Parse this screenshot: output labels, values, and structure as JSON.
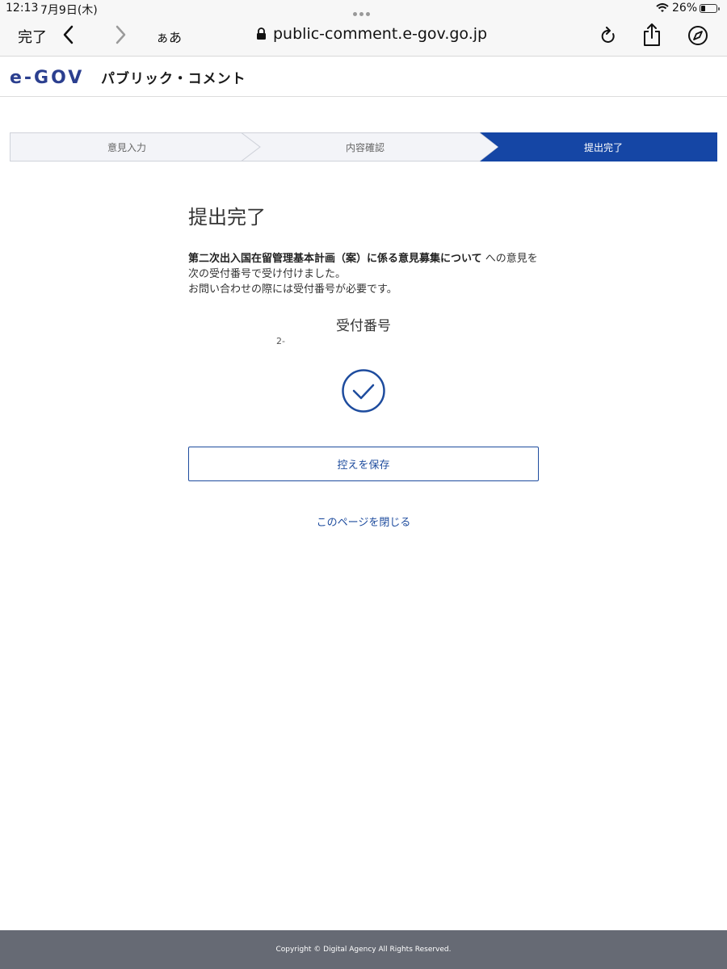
{
  "status_bar": {
    "time": "12:13",
    "date": "7月9日(木)",
    "battery": "26%"
  },
  "browser": {
    "done_label": "完了",
    "text_size_label": "ぁあ",
    "url": "public-comment.e-gov.go.jp"
  },
  "header": {
    "logo_text": "e-GOV",
    "site_title": "パブリック・コメント"
  },
  "steps": [
    {
      "label": "意見入力",
      "state": "done"
    },
    {
      "label": "内容確認",
      "state": "done"
    },
    {
      "label": "提出完了",
      "state": "current"
    }
  ],
  "main": {
    "title": "提出完了",
    "message_bold": "第二次出入国在留管理基本計画（案）に係る意見募集について",
    "message_rest": " への意見を次の受付番号で受け付けました。",
    "message_line3": "お問い合わせの際には受付番号が必要です。",
    "receipt_label": "受付番号",
    "receipt_number": "2-",
    "save_button": "控えを保存",
    "close_link": "このページを閉じる"
  },
  "footer": {
    "copyright": "Copyright © Digital Agency All Rights Reserved."
  },
  "colors": {
    "accent": "#1546a5",
    "step_inactive_bg": "#f3f4f8",
    "footer_bg": "#666a74"
  }
}
